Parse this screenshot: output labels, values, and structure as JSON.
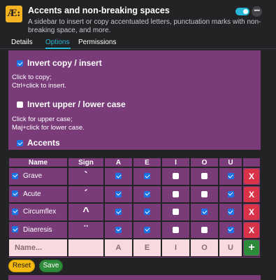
{
  "header": {
    "logo_text": "Æ:",
    "title": "Accents and non-breaking spaces",
    "description": "A sidebar to insert or copy accentuated letters, punctuation marks with non-breaking space, and more.",
    "enabled": true,
    "more_label": "•••"
  },
  "tabs": [
    {
      "label": "Details",
      "active": false
    },
    {
      "label": "Options",
      "active": true
    },
    {
      "label": "Permissions",
      "active": false
    }
  ],
  "options": {
    "invert_copy": {
      "label": "Invert copy / insert",
      "checked": true,
      "hint1": "Click to copy;",
      "hint2": "Ctrl+click to insert."
    },
    "invert_case": {
      "label": "Invert upper / lower case",
      "checked": false,
      "hint1": "Click for upper case;",
      "hint2": "Maj+click for lower case."
    },
    "accents": {
      "label": "Accents",
      "checked": true
    }
  },
  "table": {
    "headers": [
      "Name",
      "Sign",
      "A",
      "E",
      "I",
      "O",
      "U"
    ],
    "rows": [
      {
        "name": "Grave",
        "sign": "`",
        "enabled": true,
        "letters": [
          true,
          true,
          false,
          false,
          true
        ]
      },
      {
        "name": "Acute",
        "sign": "´",
        "enabled": true,
        "letters": [
          true,
          true,
          false,
          false,
          true
        ]
      },
      {
        "name": "Circumflex",
        "sign": "^",
        "enabled": true,
        "letters": [
          true,
          true,
          false,
          true,
          true
        ]
      },
      {
        "name": "Diaeresis",
        "sign": "¨",
        "enabled": true,
        "letters": [
          true,
          true,
          false,
          false,
          true
        ]
      }
    ],
    "delete_label": "X",
    "new_row": {
      "name_placeholder": "Name...",
      "letters": [
        "A",
        "E",
        "I",
        "O",
        "U"
      ],
      "add_label": "+"
    }
  },
  "buttons": {
    "reset": "Reset",
    "save": "Save"
  },
  "colors": {
    "accent": "#28b6d6",
    "panel": "#793c79",
    "delete": "#d9334a",
    "add": "#2e8b3a",
    "reset": "#f5b80f",
    "logo": "#f5b323"
  }
}
